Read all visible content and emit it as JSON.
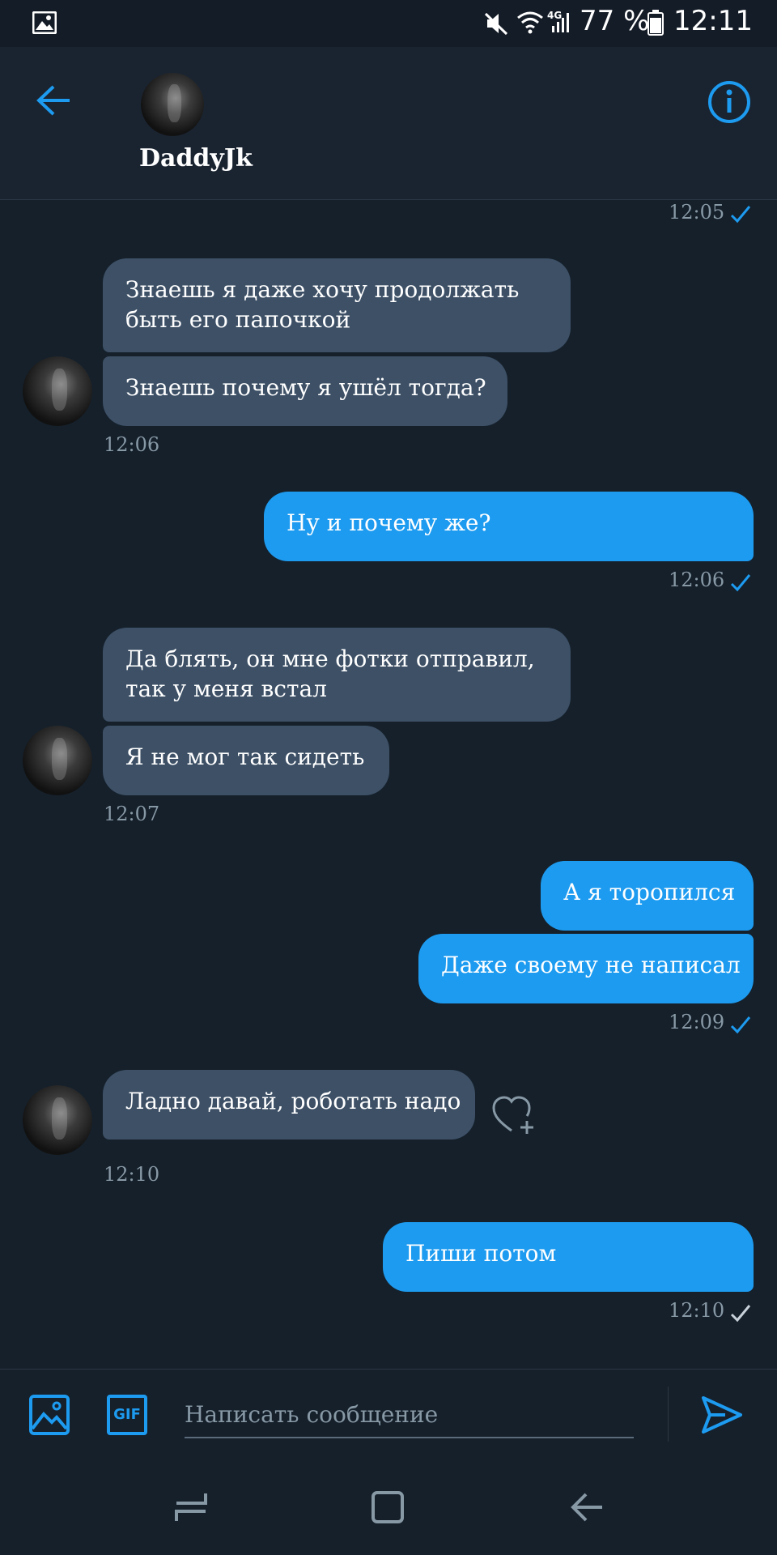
{
  "status_bar": {
    "battery": "77 %",
    "time": "12:11",
    "network": "4G"
  },
  "header": {
    "contact_name": "DaddyJk"
  },
  "messages": [
    {
      "from": "me",
      "time": "12:05",
      "status": "read"
    },
    {
      "from": "them",
      "lines": [
        "Знаешь я даже хочу продолжать быть его папочкой",
        "Знаешь почему я ушёл тогда?"
      ],
      "time": "12:06"
    },
    {
      "from": "me",
      "lines": [
        "Ну и почему же?"
      ],
      "time": "12:06",
      "status": "read"
    },
    {
      "from": "them",
      "lines": [
        "Да блять, он мне фотки отправил, так у меня встал",
        "Я не мог так сидеть"
      ],
      "time": "12:07"
    },
    {
      "from": "me",
      "lines": [
        "А я торопился",
        "Даже своему не написал"
      ],
      "time": "12:09",
      "status": "read"
    },
    {
      "from": "them",
      "lines": [
        "Ладно давай, роботать надо"
      ],
      "time": "12:10"
    },
    {
      "from": "me",
      "lines": [
        "Пиши потом"
      ],
      "time": "12:10",
      "status": "sent"
    }
  ],
  "bubbles": {
    "b1_line1": "Знаешь я даже хочу продолжать",
    "b1_line2": "быть его папочкой",
    "b2": "Знаешь почему я ушёл тогда?",
    "b3": "Ну и почему же?",
    "b4_line1": "Да блять, он мне фотки отправил,",
    "b4_line2": "так у меня встал",
    "b5": "Я не мог так сидеть",
    "b6": "А я торопился",
    "b7": "Даже своему не написал",
    "b8": "Ладно давай, роботать надо",
    "b9": "Пиши потом"
  },
  "times": {
    "t0": "12:05",
    "t1": "12:06",
    "t2": "12:06",
    "t3": "12:07",
    "t4": "12:09",
    "t5": "12:10",
    "t6": "12:10"
  },
  "composer": {
    "placeholder": "Написать сообщение",
    "gif_label": "GIF"
  },
  "colors": {
    "background": "#15202b",
    "incoming_bubble": "#3d5066",
    "outgoing_bubble": "#1d9bf0",
    "accent": "#1d9bf0",
    "timestamp": "#8899a6"
  }
}
